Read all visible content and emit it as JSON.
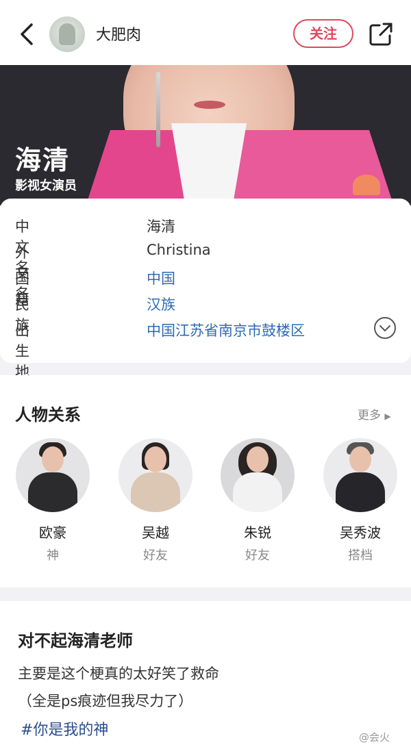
{
  "header": {
    "nickname": "大肥肉",
    "follow_label": "关注"
  },
  "hero": {
    "title": "海清",
    "subtitle": "影视女演员"
  },
  "info": {
    "rows": [
      {
        "label": "中文名",
        "value": "海清"
      },
      {
        "label": "外文名",
        "value": "Christina"
      },
      {
        "label": "国籍",
        "value": "中国"
      },
      {
        "label": "民族",
        "value": "汉族"
      },
      {
        "label": "出生地",
        "value": "中国江苏省南京市鼓楼区"
      }
    ]
  },
  "relations": {
    "title": "人物关系",
    "more_label": "更多",
    "people": [
      {
        "name": "欧豪",
        "role": "神"
      },
      {
        "name": "吴越",
        "role": "好友"
      },
      {
        "name": "朱锐",
        "role": "好友"
      },
      {
        "name": "吴秀波",
        "role": "搭档"
      }
    ]
  },
  "post": {
    "title": "对不起海清老师",
    "line1": "主要是这个梗真的太好笑了救命",
    "line2": "（全是ps痕迹但我尽力了）",
    "hashtag": "#你是我的神"
  },
  "watermark": "@会火",
  "icons": {
    "back": "chevron-left-icon",
    "share": "share-icon",
    "expand": "chevron-down-circle-icon",
    "more": "triangle-right-icon"
  },
  "colors": {
    "accent": "#e0475b",
    "link": "#2f6bb2",
    "hashtag": "#2a4d8f"
  }
}
